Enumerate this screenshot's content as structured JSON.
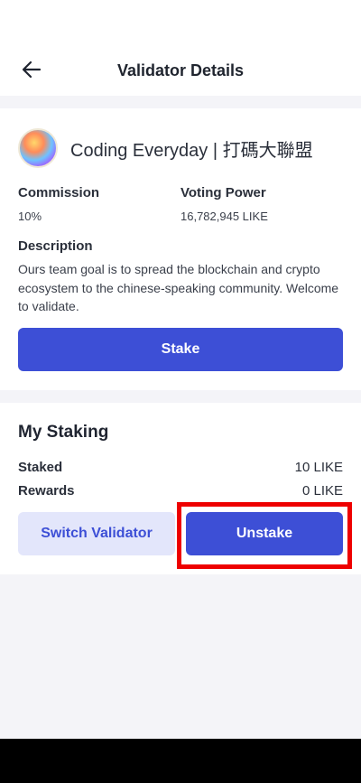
{
  "header": {
    "title": "Validator Details",
    "back_icon": "arrow-left-icon"
  },
  "validator": {
    "name": "Coding Everyday | 打碼大聯盟",
    "commission_label": "Commission",
    "commission_value": "10%",
    "voting_power_label": "Voting Power",
    "voting_power_value": "16,782,945 LIKE",
    "description_label": "Description",
    "description_text": "Ours team goal is to spread the blockchain and crypto ecosystem to the chinese-speaking community. Welcome to validate.",
    "stake_label": "Stake"
  },
  "staking": {
    "title": "My Staking",
    "staked_label": "Staked",
    "staked_value": "10 LIKE",
    "rewards_label": "Rewards",
    "rewards_value": "0 LIKE",
    "switch_label": "Switch Validator",
    "unstake_label": "Unstake"
  },
  "colors": {
    "primary": "#3d4fd6",
    "secondary_bg": "#e3e6fb",
    "highlight": "#ee0000"
  }
}
